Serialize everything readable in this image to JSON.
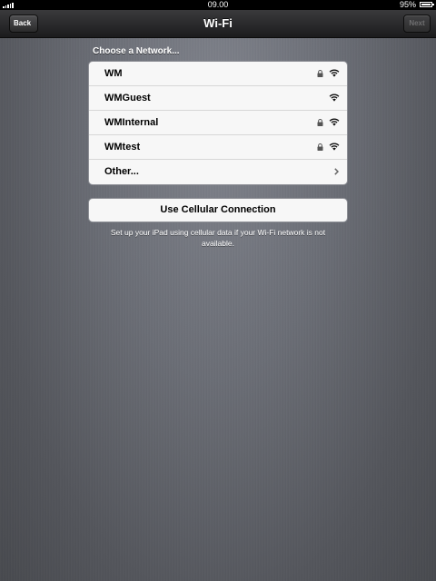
{
  "status_bar": {
    "time": "09.00",
    "battery_percent_label": "95%",
    "battery_level": 0.95,
    "signal_bars": 5
  },
  "nav_bar": {
    "back_label": "Back",
    "title": "Wi-Fi",
    "next_label": "Next"
  },
  "networks": {
    "header": "Choose a Network...",
    "items": [
      {
        "name": "WM",
        "secured": true,
        "icon": "wifi-icon"
      },
      {
        "name": "WMGuest",
        "secured": false,
        "icon": "wifi-icon"
      },
      {
        "name": "WMInternal",
        "secured": true,
        "icon": "wifi-icon"
      },
      {
        "name": "WMtest",
        "secured": true,
        "icon": "wifi-icon"
      }
    ],
    "other_label": "Other..."
  },
  "cellular": {
    "button_label": "Use Cellular Connection",
    "note": "Set up your iPad using cellular data if your Wi-Fi network is not available."
  }
}
